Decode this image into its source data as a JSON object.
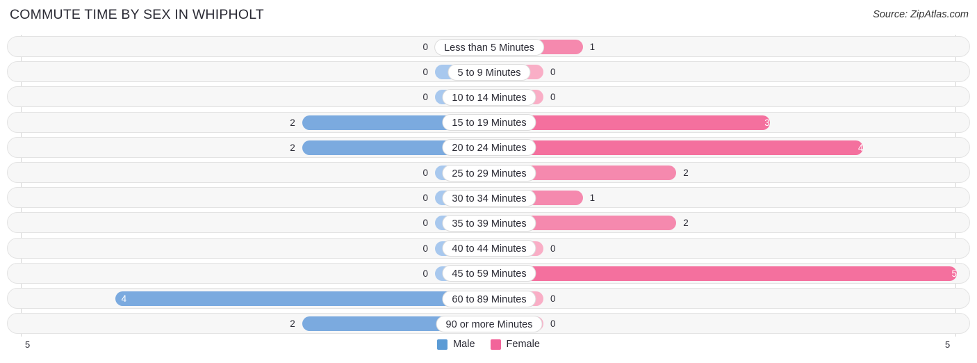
{
  "header": {
    "title": "COMMUTE TIME BY SEX IN WHIPHOLT",
    "source": "Source: ZipAtlas.com"
  },
  "legend": {
    "items": [
      {
        "label": "Male",
        "color": "#5B9BD5"
      },
      {
        "label": "Female",
        "color": "#F2649A"
      }
    ]
  },
  "axis": {
    "left_end_label": "5",
    "right_end_label": "5"
  },
  "colors": {
    "male_strong": "#7BAADF",
    "male_light": "#A8C8EE",
    "female_strong": "#F4709E",
    "female_mid": "#F589AE",
    "female_light": "#F9AEC6",
    "track_bg": "#F7F7F7",
    "track_border": "#E3E3E3",
    "axis_line": "#D4D4D4",
    "text": "#2B2B35"
  },
  "chart_data": {
    "type": "bar",
    "title": "COMMUTE TIME BY SEX IN WHIPHOLT",
    "subtype": "diverging-horizontal-bar",
    "xlabel": "",
    "ylabel": "",
    "xlim": [
      -5,
      5
    ],
    "axis_max": 5,
    "grid": false,
    "legend_position": "bottom-center",
    "categories": [
      "Less than 5 Minutes",
      "5 to 9 Minutes",
      "10 to 14 Minutes",
      "15 to 19 Minutes",
      "20 to 24 Minutes",
      "25 to 29 Minutes",
      "30 to 34 Minutes",
      "35 to 39 Minutes",
      "40 to 44 Minutes",
      "45 to 59 Minutes",
      "60 to 89 Minutes",
      "90 or more Minutes"
    ],
    "series": [
      {
        "name": "Male",
        "direction": "left",
        "values": [
          0,
          0,
          0,
          2,
          2,
          0,
          0,
          0,
          0,
          0,
          4,
          2
        ]
      },
      {
        "name": "Female",
        "direction": "right",
        "values": [
          1,
          0,
          0,
          3,
          4,
          2,
          1,
          2,
          0,
          5,
          0,
          0
        ]
      }
    ]
  },
  "rows": [
    {
      "label": "Less than 5 Minutes",
      "male": "0",
      "female": "1"
    },
    {
      "label": "5 to 9 Minutes",
      "male": "0",
      "female": "0"
    },
    {
      "label": "10 to 14 Minutes",
      "male": "0",
      "female": "0"
    },
    {
      "label": "15 to 19 Minutes",
      "male": "2",
      "female": "3"
    },
    {
      "label": "20 to 24 Minutes",
      "male": "2",
      "female": "4"
    },
    {
      "label": "25 to 29 Minutes",
      "male": "0",
      "female": "2"
    },
    {
      "label": "30 to 34 Minutes",
      "male": "0",
      "female": "1"
    },
    {
      "label": "35 to 39 Minutes",
      "male": "0",
      "female": "2"
    },
    {
      "label": "40 to 44 Minutes",
      "male": "0",
      "female": "0"
    },
    {
      "label": "45 to 59 Minutes",
      "male": "0",
      "female": "5"
    },
    {
      "label": "60 to 89 Minutes",
      "male": "4",
      "female": "0"
    },
    {
      "label": "90 or more Minutes",
      "male": "2",
      "female": "0"
    }
  ]
}
